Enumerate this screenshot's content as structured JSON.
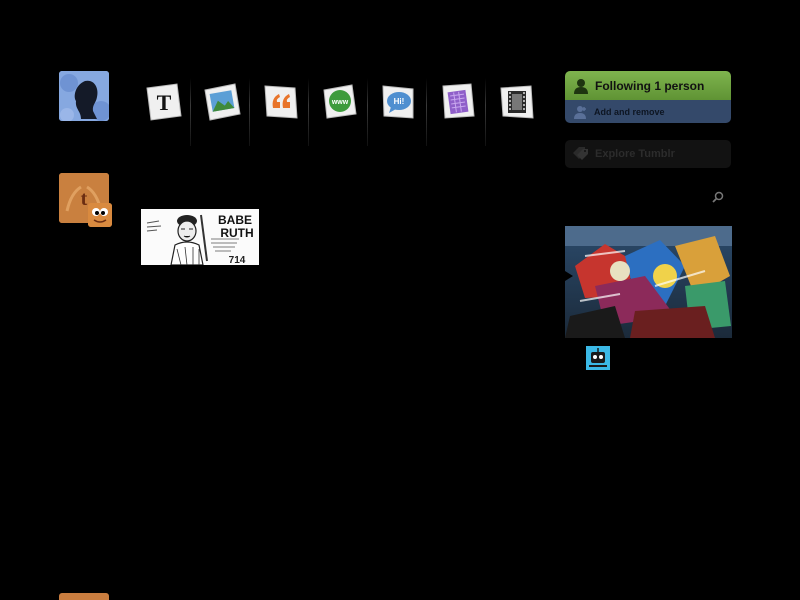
{
  "sidebar_avatars": {
    "user_icon": "silhouette-avatar-icon",
    "tumblr_icon": "tumblr-avatar-icon"
  },
  "post_types": [
    {
      "name": "text",
      "icon": "text-post-icon",
      "glyph": "T"
    },
    {
      "name": "photo",
      "icon": "photo-post-icon"
    },
    {
      "name": "quote",
      "icon": "quote-post-icon"
    },
    {
      "name": "link",
      "icon": "link-post-icon",
      "glyph": "www"
    },
    {
      "name": "chat",
      "icon": "chat-post-icon",
      "glyph": "Hi!"
    },
    {
      "name": "audio",
      "icon": "audio-post-icon"
    },
    {
      "name": "video",
      "icon": "video-post-icon"
    }
  ],
  "follow": {
    "following_label": "Following 1 person",
    "manage_label": "Add and remove"
  },
  "explore": {
    "label": "Explore Tumblr"
  },
  "post": {
    "thumb_title": "BABE RUTH"
  },
  "colors": {
    "follow_green": "#6ea442",
    "manage_blue": "#34496a",
    "background": "#000000"
  }
}
